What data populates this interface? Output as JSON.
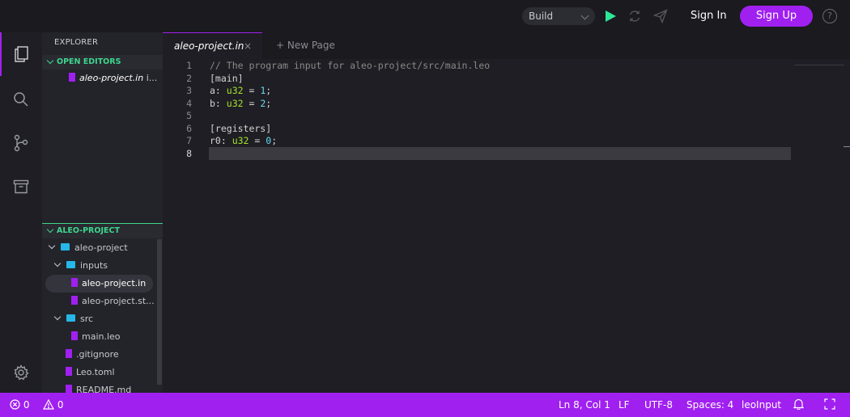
{
  "topbar": {
    "build_label": "Build",
    "sign_in": "Sign In",
    "sign_up": "Sign Up",
    "help_glyph": "?",
    "colors": {
      "accent": "#a020f0",
      "run": "#2ee89a"
    }
  },
  "activity_bar": {
    "icons": [
      "files-icon",
      "search-icon",
      "source-control-icon",
      "archive-icon",
      "settings-icon"
    ]
  },
  "sidebar": {
    "title": "EXPLORER",
    "open_editors": {
      "header": "OPEN EDITORS",
      "items": [
        {
          "name": "aleo-project.in",
          "suffix": "i..."
        }
      ]
    },
    "project": {
      "header": "ALEO-PROJECT",
      "tree": [
        {
          "label": "aleo-project",
          "kind": "folder"
        },
        {
          "label": "inputs",
          "kind": "folder"
        },
        {
          "label": "aleo-project.in",
          "kind": "file"
        },
        {
          "label": "aleo-project.st...",
          "kind": "file"
        },
        {
          "label": "src",
          "kind": "folder"
        },
        {
          "label": "main.leo",
          "kind": "file"
        },
        {
          "label": ".gitignore",
          "kind": "file"
        },
        {
          "label": "Leo.toml",
          "kind": "file"
        },
        {
          "label": "README.md",
          "kind": "file"
        }
      ]
    }
  },
  "tabs": {
    "active": {
      "label": "aleo-project.in",
      "close": "×"
    },
    "new_page": "+ New Page"
  },
  "editor": {
    "line_numbers": [
      "1",
      "2",
      "3",
      "4",
      "5",
      "6",
      "7",
      "8"
    ],
    "lines": {
      "l1": "// The program input for aleo-project/src/main.leo",
      "l2": "[main]",
      "l3_name": "a: ",
      "l3_type": "u32",
      "l3_eq": " = ",
      "l3_num": "1",
      "l3_end": ";",
      "l4_name": "b: ",
      "l4_type": "u32",
      "l4_eq": " = ",
      "l4_num": "2",
      "l4_end": ";",
      "l6": "[registers]",
      "l7_name": "r0: ",
      "l7_type": "u32",
      "l7_eq": " = ",
      "l7_num": "0",
      "l7_end": ";"
    }
  },
  "status": {
    "errors": "0",
    "warnings": "0",
    "position": "Ln 8, Col 1",
    "eol": "LF",
    "encoding": "UTF-8",
    "spaces": "Spaces: 4",
    "language": "leoInput"
  }
}
